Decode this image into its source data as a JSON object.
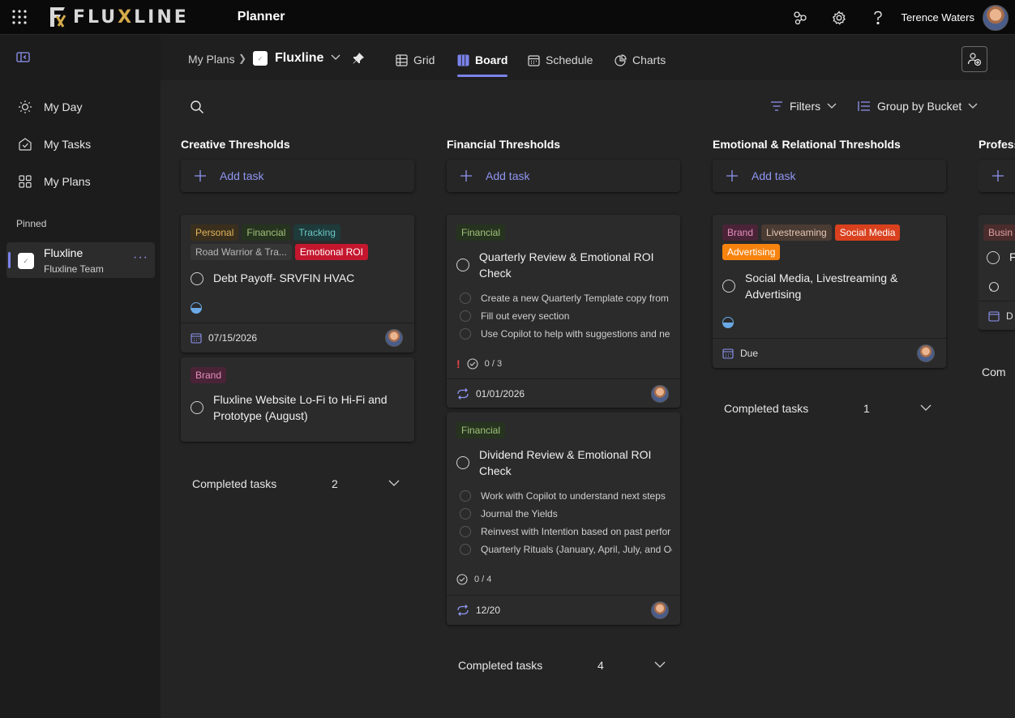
{
  "topbar": {
    "logo_prefix": "FLU",
    "logo_x": "X",
    "logo_suffix": "LINE",
    "app_name": "Planner",
    "user_name": "Terence Waters"
  },
  "sidebar": {
    "nav": [
      {
        "label": "My Day",
        "icon": "sun-icon"
      },
      {
        "label": "My Tasks",
        "icon": "tasks-icon"
      },
      {
        "label": "My Plans",
        "icon": "plans-grid-icon"
      }
    ],
    "pinned_label": "Pinned",
    "pinned_plan": {
      "title": "Fluxline",
      "subtitle": "Fluxline Team"
    }
  },
  "header": {
    "breadcrumb": "My Plans",
    "plan_name": "Fluxline",
    "tabs": [
      {
        "label": "Grid",
        "icon": "grid-icon"
      },
      {
        "label": "Board",
        "icon": "board-icon",
        "active": true
      },
      {
        "label": "Schedule",
        "icon": "calendar-icon"
      },
      {
        "label": "Charts",
        "icon": "charts-icon"
      }
    ]
  },
  "toolbar": {
    "filters_label": "Filters",
    "groupby_label": "Group by Bucket"
  },
  "buckets": [
    {
      "title": "Creative Thresholds",
      "add_label": "Add task",
      "cards": [
        {
          "labels": [
            "Personal",
            "Financial",
            "Tracking",
            "Road Warrior & Tra...",
            "Emotional ROI"
          ],
          "title": "Debt Payoff- SRVFIN HVAC",
          "due": "07/15/2026"
        },
        {
          "labels": [
            "Brand"
          ],
          "title": "Fluxline Website Lo-Fi to Hi-Fi and Prototype (August)"
        }
      ],
      "completed_label": "Completed tasks",
      "completed_count": "2"
    },
    {
      "title": "Financial Thresholds",
      "add_label": "Add task",
      "cards": [
        {
          "labels": [
            "Financial"
          ],
          "title": "Quarterly Review & Emotional ROI Check",
          "subtasks": [
            "Create a new Quarterly Template copy from",
            "Fill out every section",
            "Use Copilot to help with suggestions and ne"
          ],
          "priority": "!",
          "checklist": "0 / 3",
          "due": "01/01/2026"
        },
        {
          "labels": [
            "Financial"
          ],
          "title": "Dividend Review & Emotional ROI Check",
          "subtasks": [
            "Work with Copilot to understand next steps",
            "Journal the Yields",
            "Reinvest with Intention based on past perfor",
            "Quarterly Rituals (January, April, July, and Oc"
          ],
          "checklist": "0 / 4",
          "due": "12/20"
        }
      ],
      "completed_label": "Completed tasks",
      "completed_count": "4"
    },
    {
      "title": "Emotional & Relational Thresholds",
      "add_label": "Add task",
      "cards": [
        {
          "labels": [
            "Brand",
            "Livestreaming",
            "Social Media",
            "Advertising"
          ],
          "title": "Social Media, Livestreaming & Advertising",
          "due": "Due"
        }
      ],
      "completed_label": "Completed tasks",
      "completed_count": "1"
    },
    {
      "title": "Profess",
      "label_partial": "Busin",
      "letter": "F",
      "due_partial": "D",
      "completed_partial": "Com"
    }
  ],
  "colors": {
    "accent": "#7b83eb",
    "emotional_roi": "#c4172e",
    "social_media": "#d9411e",
    "advertising": "#f7830f",
    "priority": "#e8474b"
  }
}
